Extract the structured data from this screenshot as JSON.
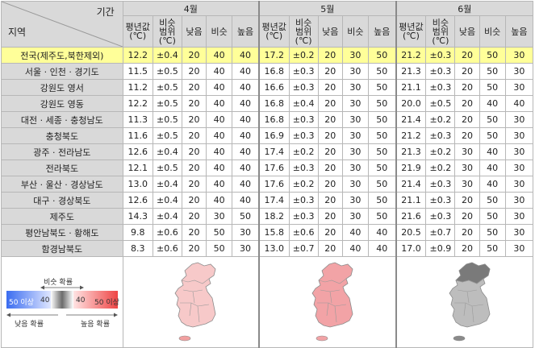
{
  "corner": {
    "period": "기간",
    "region": "지역"
  },
  "months": [
    "4월",
    "5월",
    "6월"
  ],
  "subheaders": {
    "mean": [
      "평년값",
      "(℃)"
    ],
    "similar_range": [
      "비슷",
      "범위",
      "(℃)"
    ],
    "low": "낮음",
    "similar": "비슷",
    "high": "높음"
  },
  "rows": [
    {
      "region": "전국(제주도,북한제외)",
      "national": true,
      "m4": [
        "12.2",
        "±0.4",
        "20",
        "40",
        "40"
      ],
      "m5": [
        "17.2",
        "±0.2",
        "20",
        "30",
        "50"
      ],
      "m6": [
        "21.2",
        "±0.3",
        "20",
        "50",
        "30"
      ]
    },
    {
      "region": "서울 · 인천 · 경기도",
      "m4": [
        "11.5",
        "±0.5",
        "20",
        "40",
        "40"
      ],
      "m5": [
        "16.8",
        "±0.3",
        "20",
        "30",
        "50"
      ],
      "m6": [
        "21.3",
        "±0.3",
        "20",
        "50",
        "30"
      ]
    },
    {
      "region": "강원도 영서",
      "m4": [
        "11.2",
        "±0.5",
        "20",
        "40",
        "40"
      ],
      "m5": [
        "16.6",
        "±0.3",
        "20",
        "30",
        "50"
      ],
      "m6": [
        "21.1",
        "±0.3",
        "20",
        "50",
        "30"
      ]
    },
    {
      "region": "강원도 영동",
      "m4": [
        "12.2",
        "±0.5",
        "20",
        "40",
        "40"
      ],
      "m5": [
        "16.8",
        "±0.4",
        "20",
        "30",
        "50"
      ],
      "m6": [
        "20.0",
        "±0.5",
        "20",
        "40",
        "40"
      ]
    },
    {
      "region": "대전 · 세종 · 충청남도",
      "m4": [
        "11.3",
        "±0.5",
        "20",
        "40",
        "40"
      ],
      "m5": [
        "16.8",
        "±0.3",
        "20",
        "30",
        "50"
      ],
      "m6": [
        "21.4",
        "±0.2",
        "20",
        "50",
        "30"
      ]
    },
    {
      "region": "충청북도",
      "m4": [
        "11.6",
        "±0.5",
        "20",
        "40",
        "40"
      ],
      "m5": [
        "16.9",
        "±0.3",
        "20",
        "30",
        "50"
      ],
      "m6": [
        "21.2",
        "±0.3",
        "20",
        "50",
        "30"
      ]
    },
    {
      "region": "광주 · 전라남도",
      "m4": [
        "12.6",
        "±0.4",
        "20",
        "40",
        "40"
      ],
      "m5": [
        "17.4",
        "±0.2",
        "20",
        "30",
        "50"
      ],
      "m6": [
        "21.3",
        "±0.2",
        "30",
        "40",
        "30"
      ]
    },
    {
      "region": "전라북도",
      "m4": [
        "12.1",
        "±0.5",
        "20",
        "40",
        "40"
      ],
      "m5": [
        "17.6",
        "±0.3",
        "20",
        "30",
        "50"
      ],
      "m6": [
        "21.9",
        "±0.2",
        "30",
        "40",
        "30"
      ]
    },
    {
      "region": "부산 · 울산 · 경상남도",
      "m4": [
        "13.0",
        "±0.4",
        "20",
        "40",
        "40"
      ],
      "m5": [
        "17.6",
        "±0.2",
        "20",
        "30",
        "50"
      ],
      "m6": [
        "21.4",
        "±0.3",
        "30",
        "40",
        "30"
      ]
    },
    {
      "region": "대구 · 경상북도",
      "m4": [
        "12.6",
        "±0.4",
        "20",
        "40",
        "40"
      ],
      "m5": [
        "17.4",
        "±0.3",
        "20",
        "30",
        "50"
      ],
      "m6": [
        "21.1",
        "±0.3",
        "20",
        "50",
        "30"
      ]
    },
    {
      "region": "제주도",
      "m4": [
        "14.3",
        "±0.4",
        "20",
        "30",
        "50"
      ],
      "m5": [
        "18.2",
        "±0.3",
        "20",
        "30",
        "50"
      ],
      "m6": [
        "21.6",
        "±0.3",
        "20",
        "50",
        "30"
      ]
    },
    {
      "region": "평안남북도 · 황해도",
      "m4": [
        "9.8",
        "±0.6",
        "20",
        "50",
        "30"
      ],
      "m5": [
        "15.8",
        "±0.6",
        "20",
        "40",
        "40"
      ],
      "m6": [
        "20.5",
        "±0.7",
        "20",
        "50",
        "30"
      ]
    },
    {
      "region": "함경남북도",
      "m4": [
        "8.3",
        "±0.6",
        "20",
        "50",
        "30"
      ],
      "m5": [
        "13.0",
        "±0.7",
        "20",
        "40",
        "40"
      ],
      "m6": [
        "17.0",
        "±0.9",
        "20",
        "50",
        "30"
      ]
    }
  ],
  "legend": {
    "similar_prob": "비슷 확률",
    "low_prob": "낮음 확률",
    "high_prob": "높음 확률",
    "low_max": "50 이상",
    "low_40": "40",
    "high_40": "40",
    "high_max": "50 이상",
    "colors": {
      "low_dark": "#3a6cf0",
      "low_light": "#dfe6ff",
      "mid": "#6b6b6b",
      "high_light": "#ffe3e3",
      "high_dark": "#ee4444"
    }
  },
  "maps": [
    {
      "month": "4월",
      "fill": "#f7c9c9",
      "jeju": "#f2a0a0"
    },
    {
      "month": "5월",
      "fill": "#f2a3a6",
      "jeju": "#f2a3a6"
    },
    {
      "month": "6월",
      "fill": "#bdbdbd",
      "jeju": "#8a8a8a",
      "north": "#7a7a7a"
    }
  ]
}
